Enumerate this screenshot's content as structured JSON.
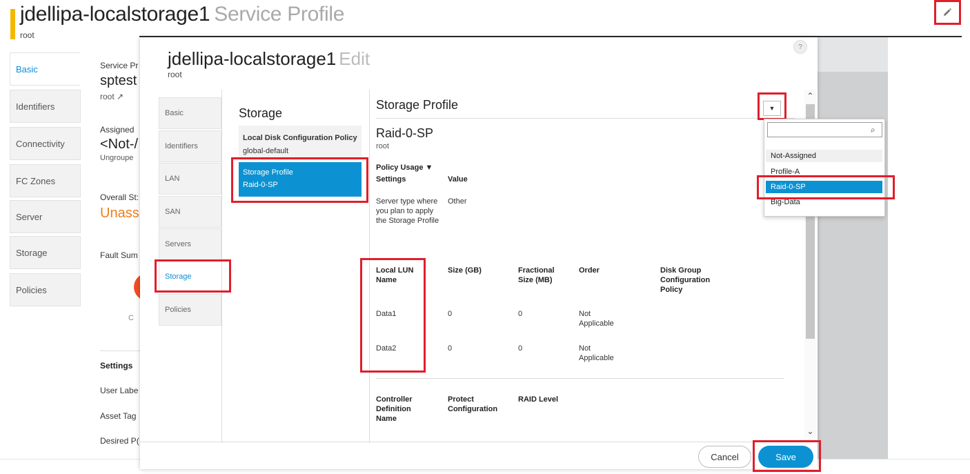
{
  "header": {
    "title": "jdellipa-localstorage1",
    "subtitle": "Service Profile",
    "org": "root"
  },
  "outer_tabs": [
    "Basic",
    "Identifiers",
    "Connectivity",
    "FC Zones",
    "Server",
    "Storage",
    "Policies"
  ],
  "background_summary": {
    "service_profile_label": "Service Pr",
    "service_profile_value": "sptest",
    "org_value": "root",
    "assigned_label": "Assigned",
    "assigned_value": "<Not-/",
    "ungrouped": "Ungroupe",
    "overall_status_label": "Overall St:",
    "overall_status_value": "Unass",
    "fault_summary_label": "Fault Sum",
    "fault_c": "C",
    "settings_heading": "Settings",
    "user_label": "User Labe",
    "asset_tag": "Asset Tag",
    "desired_power": "Desired P("
  },
  "modal": {
    "title": "jdellipa-localstorage1",
    "subtitle": "Edit",
    "org": "root",
    "help": "?",
    "inner_tabs": [
      "Basic",
      "Identifiers",
      "LAN",
      "SAN",
      "Servers",
      "Storage",
      "Policies"
    ],
    "storage": {
      "heading": "Storage",
      "ldcp_label": "Local Disk Configuration Policy",
      "ldcp_value": "global-default",
      "sp_label": "Storage Profile",
      "sp_value": "Raid-0-SP"
    },
    "storage_profile": {
      "heading": "Storage Profile",
      "name": "Raid-0-SP",
      "org": "root",
      "policy_usage": "Policy Usage ▼",
      "settings_header": "Settings",
      "value_header": "Value",
      "server_type_label": "Server type where you plan to apply the Storage Profile",
      "server_type_value": "Other",
      "lun_headers": [
        "Local LUN Name",
        "Size (GB)",
        "Fractional Size (MB)",
        "Order",
        "Disk Group Configuration Policy"
      ],
      "luns": [
        {
          "name": "Data1",
          "size": "0",
          "fractional": "0",
          "order": "Not Applicable"
        },
        {
          "name": "Data2",
          "size": "0",
          "fractional": "0",
          "order": "Not Applicable"
        }
      ],
      "controller_headers": [
        "Controller Definition Name",
        "Protect Configuration",
        "RAID Level"
      ]
    },
    "dropdown": {
      "search_value": "",
      "options": [
        "Not-Assigned",
        "Profile-A",
        "Raid-0-SP",
        "Big-Data"
      ],
      "selected": "Raid-0-SP"
    },
    "buttons": {
      "cancel": "Cancel",
      "save": "Save"
    }
  },
  "colors": {
    "accent": "#0c92d2",
    "highlight_box": "#e01e2b",
    "title_bar": "#f5b800",
    "status_orange": "#f07d1b"
  },
  "icons": [
    "pencil-icon",
    "external-link-icon",
    "search-icon",
    "caret-down-icon",
    "help-icon",
    "scroll-up-icon",
    "scroll-down-icon"
  ]
}
